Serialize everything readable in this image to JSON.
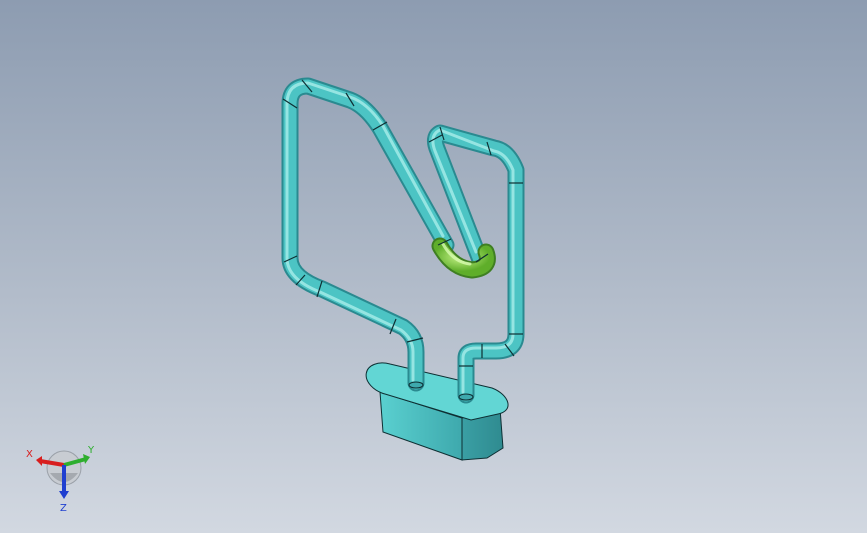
{
  "viewport": {
    "background_top": "#8d9cb1",
    "background_bottom": "#d2d8e1"
  },
  "model": {
    "tube_color": "#4cc4c4",
    "tube_shadow": "#2e8f95",
    "tube_highlight": "#aef0ec",
    "selected_color": "#7dd43b",
    "edge_color": "#0e2f33"
  },
  "triad": {
    "x_label": "X",
    "y_label": "Y",
    "z_label": "Z",
    "x_color": "#d81e1e",
    "y_color": "#2eae2e",
    "z_color": "#1f3fd0",
    "icon": "axis-triad-icon"
  }
}
